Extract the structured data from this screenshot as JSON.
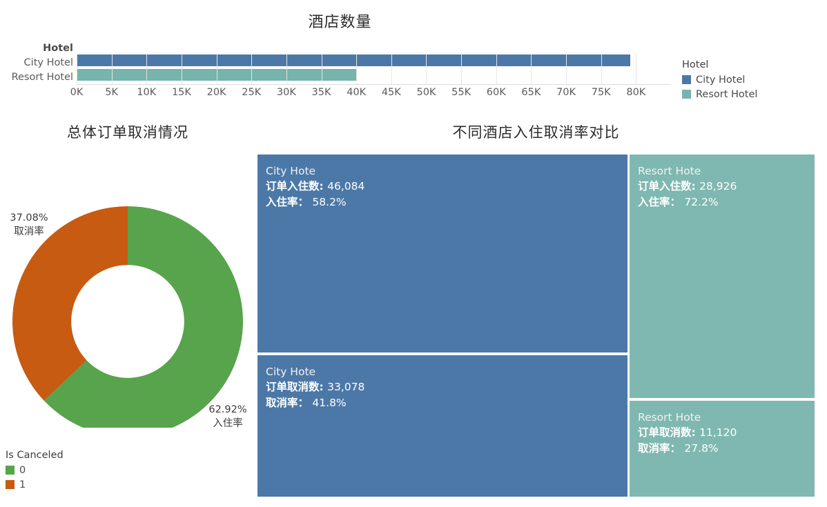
{
  "bar_chart": {
    "title": "酒店数量",
    "axis_caption": "Hotel",
    "row_labels": [
      "City Hotel",
      "Resort Hotel"
    ],
    "tick_labels": [
      "0K",
      "5K",
      "10K",
      "15K",
      "20K",
      "25K",
      "30K",
      "35K",
      "40K",
      "45K",
      "50K",
      "55K",
      "60K",
      "65K",
      "70K",
      "75K",
      "80K"
    ],
    "legend": {
      "title": "Hotel",
      "items": [
        {
          "label": "City Hotel",
          "color": "#4c78a8"
        },
        {
          "label": "Resort Hotel",
          "color": "#76b4ac"
        }
      ]
    }
  },
  "donut_chart": {
    "title": "总体订单取消情况",
    "annotation_cancel_pct": "37.08%",
    "annotation_cancel_label": "取消率",
    "annotation_checkin_pct": "62.92%",
    "annotation_checkin_label": "入住率",
    "legend": {
      "title": "Is Canceled",
      "items": [
        {
          "label": "0",
          "color": "#57a44c"
        },
        {
          "label": "1",
          "color": "#c75b12"
        }
      ]
    }
  },
  "treemap": {
    "title": "不同酒店入住取消率对比",
    "cells": [
      {
        "id": "city-checkin",
        "name": "City Hote",
        "metric_label": "订单入住数:",
        "metric_value": "46,084",
        "rate_label": "入住率：",
        "rate_value": "58.2%",
        "color": "#4c78a8"
      },
      {
        "id": "city-cancel",
        "name": "City Hote",
        "metric_label": "订单取消数:",
        "metric_value": "33,078",
        "rate_label": "取消率：",
        "rate_value": "41.8%",
        "color": "#4c78a8"
      },
      {
        "id": "resort-checkin",
        "name": "Resort Hote",
        "metric_label": "订单入住数:",
        "metric_value": "28,926",
        "rate_label": "入住率：",
        "rate_value": "72.2%",
        "color": "#7fb8b0"
      },
      {
        "id": "resort-cancel",
        "name": "Resort Hote",
        "metric_label": "订单取消数:",
        "metric_value": "11,120",
        "rate_label": "取消率：",
        "rate_value": "27.8%",
        "color": "#7fb8b0"
      }
    ]
  },
  "chart_data": [
    {
      "type": "bar",
      "title": "酒店数量",
      "orientation": "horizontal",
      "categories": [
        "City Hotel",
        "Resort Hotel"
      ],
      "values": [
        79162,
        40046
      ],
      "xlabel": "",
      "ylabel": "Hotel",
      "xlim": [
        0,
        85000
      ],
      "xticks": [
        0,
        5000,
        10000,
        15000,
        20000,
        25000,
        30000,
        35000,
        40000,
        45000,
        50000,
        55000,
        60000,
        65000,
        70000,
        75000,
        80000
      ],
      "xtick_labels": [
        "0K",
        "5K",
        "10K",
        "15K",
        "20K",
        "25K",
        "30K",
        "35K",
        "40K",
        "45K",
        "50K",
        "55K",
        "60K",
        "65K",
        "70K",
        "75K",
        "80K"
      ],
      "grid": true,
      "legend": {
        "position": "right",
        "title": "Hotel",
        "entries": [
          "City Hotel",
          "Resort Hotel"
        ]
      },
      "colors": [
        "#4c78a8",
        "#76b4ac"
      ]
    },
    {
      "type": "pie",
      "subtype": "donut",
      "title": "总体订单取消情况",
      "labels": [
        "0",
        "1"
      ],
      "label_names": [
        "入住率",
        "取消率"
      ],
      "values": [
        62.92,
        37.08
      ],
      "value_unit": "%",
      "annotations": [
        "62.92% 入住率",
        "37.08% 取消率"
      ],
      "start_angle_deg": 0,
      "direction": "clockwise",
      "inner_radius_ratio": 0.49,
      "legend": {
        "position": "bottom-left",
        "title": "Is Canceled",
        "entries": [
          "0",
          "1"
        ]
      },
      "colors": [
        "#57a44c",
        "#c75b12"
      ]
    },
    {
      "type": "treemap",
      "title": "不同酒店入住取消率对比",
      "categories": [
        "City Hote 入住",
        "City Hote 取消",
        "Resort Hote 入住",
        "Resort Hote 取消"
      ],
      "values": [
        46084,
        33078,
        28926,
        11120
      ],
      "percentages": [
        58.2,
        41.8,
        72.2,
        27.8
      ],
      "groups": [
        "City Hotel",
        "City Hotel",
        "Resort Hotel",
        "Resort Hotel"
      ],
      "colors": [
        "#4c78a8",
        "#4c78a8",
        "#7fb8b0",
        "#7fb8b0"
      ],
      "grid": false,
      "legend": {
        "position": "none",
        "entries": []
      }
    }
  ]
}
